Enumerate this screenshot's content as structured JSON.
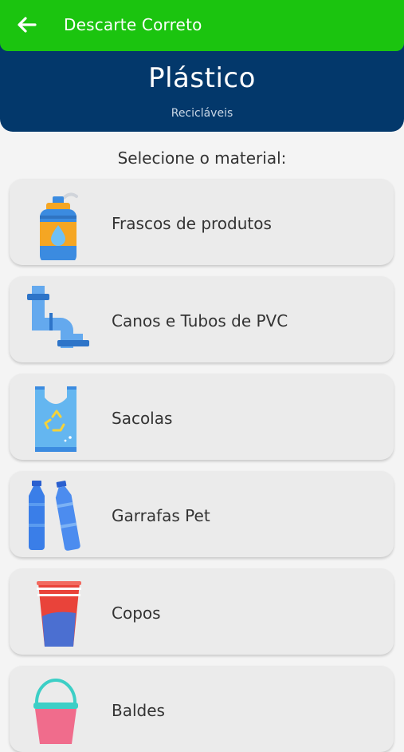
{
  "appbar": {
    "title": "Descarte Correto",
    "back_icon": "arrow-left-icon"
  },
  "header": {
    "title": "Plástico",
    "subtitle": "Recicláveis"
  },
  "prompt": "Selecione o material:",
  "colors": {
    "appbar": "#1bc40f",
    "header": "#03386b",
    "card": "#ebebeb",
    "background": "#f4f4f4"
  },
  "materials": [
    {
      "label": "Frascos de produtos",
      "icon": "spray-bottle-icon"
    },
    {
      "label": "Canos e Tubos de PVC",
      "icon": "pvc-pipe-icon"
    },
    {
      "label": "Sacolas",
      "icon": "plastic-bag-icon"
    },
    {
      "label": "Garrafas Pet",
      "icon": "pet-bottles-icon"
    },
    {
      "label": "Copos",
      "icon": "plastic-cups-icon"
    },
    {
      "label": "Baldes",
      "icon": "bucket-icon"
    }
  ]
}
